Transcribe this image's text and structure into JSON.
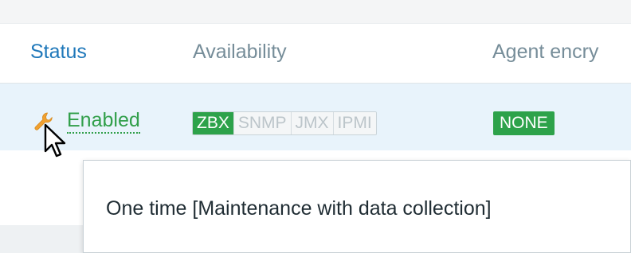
{
  "table": {
    "columns": {
      "status": "Status",
      "availability": "Availability",
      "agent_encryption": "Agent encry"
    },
    "row": {
      "status_label": "Enabled",
      "status_icon": "wrench-icon",
      "availability_badges": [
        "ZBX",
        "SNMP",
        "JMX",
        "IPMI"
      ],
      "active_badge": "ZBX",
      "encryption": "NONE"
    }
  },
  "tooltip": {
    "text": "One time [Maintenance with data collection]"
  },
  "colors": {
    "link_blue": "#1f78ba",
    "enabled_green": "#319f4a",
    "badge_green": "#2da24a",
    "row_highlight": "#e8f3fb",
    "wrench_orange": "#f0a030"
  }
}
